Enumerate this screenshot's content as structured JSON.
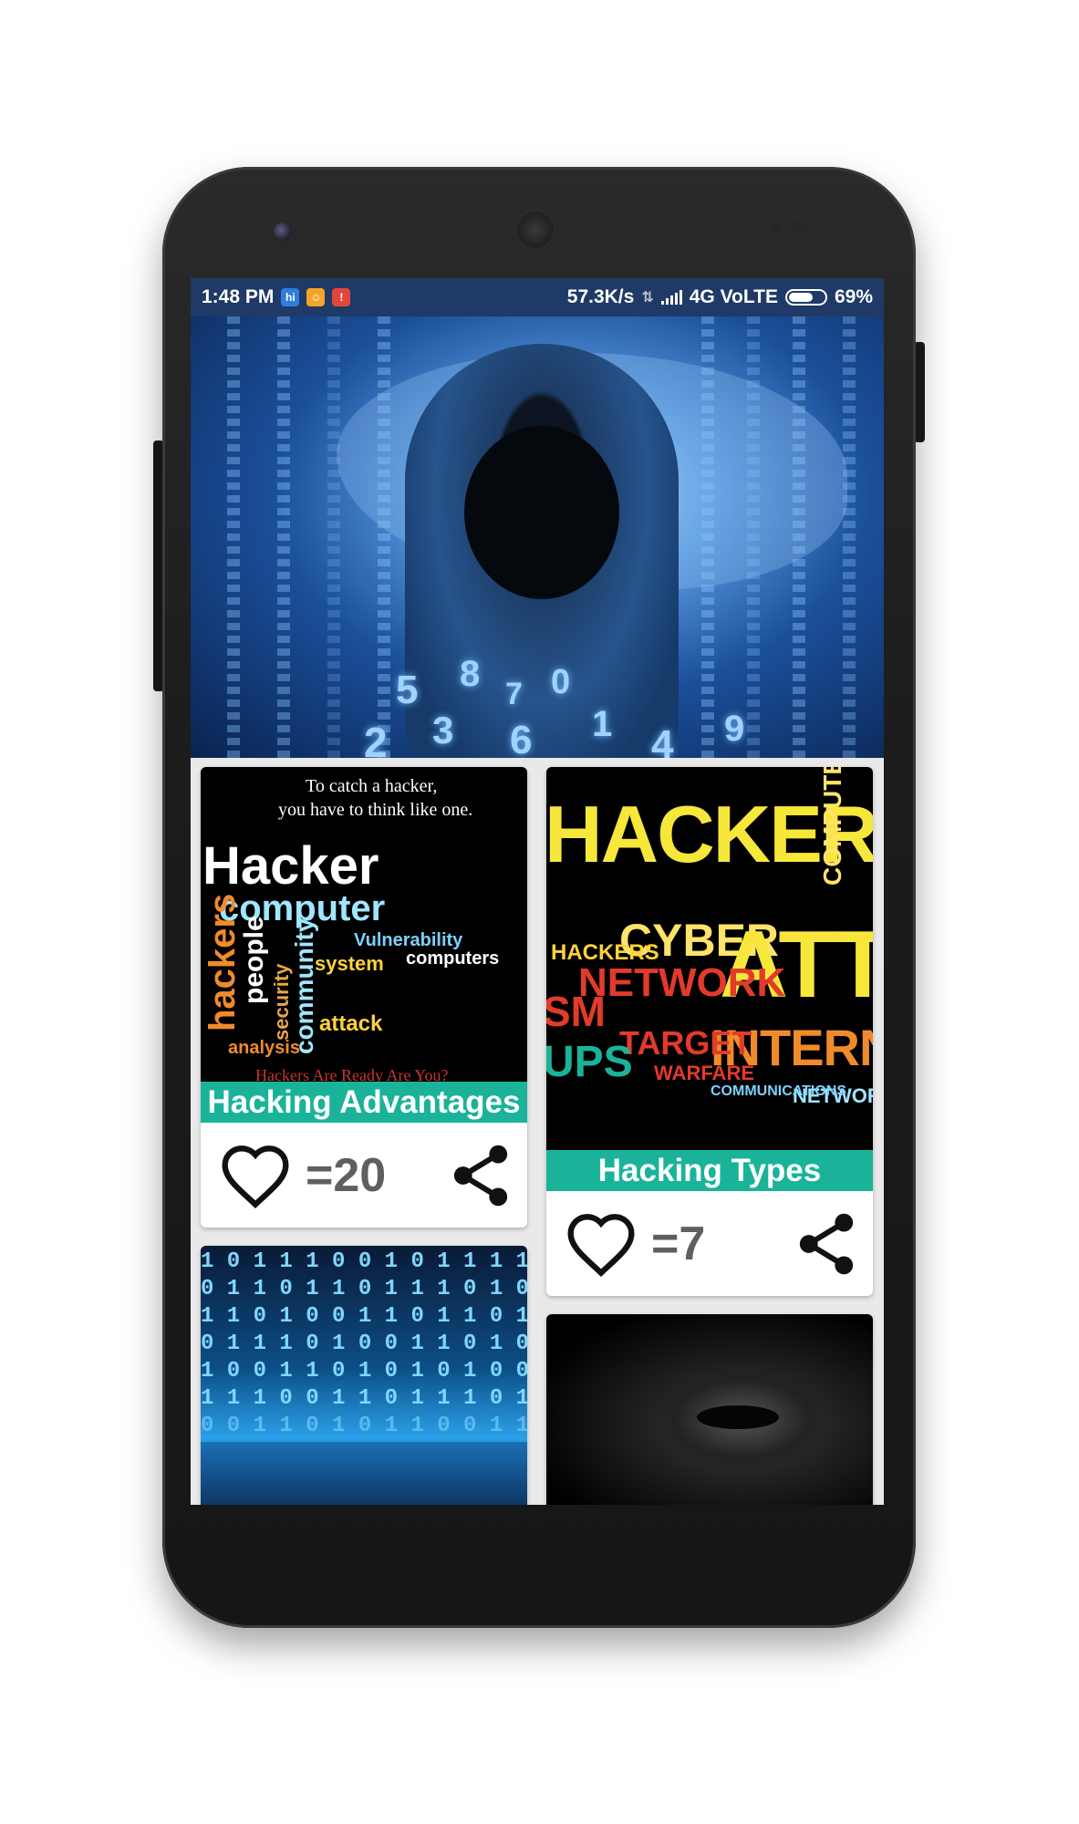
{
  "statusbar": {
    "time": "1:48 PM",
    "notif_icons": [
      "hi",
      "chat",
      "app"
    ],
    "speed": "57.3K/s",
    "network": "4G VoLTE",
    "battery": "69%",
    "battery_level": 0.69
  },
  "hero": {
    "digits": [
      "5",
      "8",
      "7",
      "0",
      "2",
      "3",
      "6",
      "1",
      "4",
      "9"
    ]
  },
  "cards": [
    {
      "image_text": {
        "quote_line1": "To catch a hacker,",
        "quote_line2": "you have to think like one.",
        "word1": "Hacker",
        "word2": "computer",
        "word3": "hackers",
        "word4": "people",
        "word5": "security",
        "word6": "community",
        "word7": "Vulnerability",
        "word8": "system",
        "word9": "computers",
        "word10": "attack",
        "word11": "analysis",
        "footer": "Hackers Are Ready Are You?"
      },
      "title": "Hacking Advantages",
      "likes": "=20"
    },
    {
      "image_text": {
        "w1": "HACKER",
        "w2": "CYBER",
        "w3": "ATTA",
        "w4": "NETWORK",
        "w5": "INTERNET",
        "w6": "TARGET",
        "w7": "HACKERS",
        "w8": "COMPUTER",
        "w9": "NETWORKS",
        "w10": "COMMUNICATIONS",
        "w11": "WARFARE",
        "w12": "UPS",
        "w13": "SM"
      },
      "title": "Hacking Types",
      "likes": "=7"
    }
  ],
  "icons": {
    "heart": "heart-icon",
    "share": "share-icon"
  }
}
